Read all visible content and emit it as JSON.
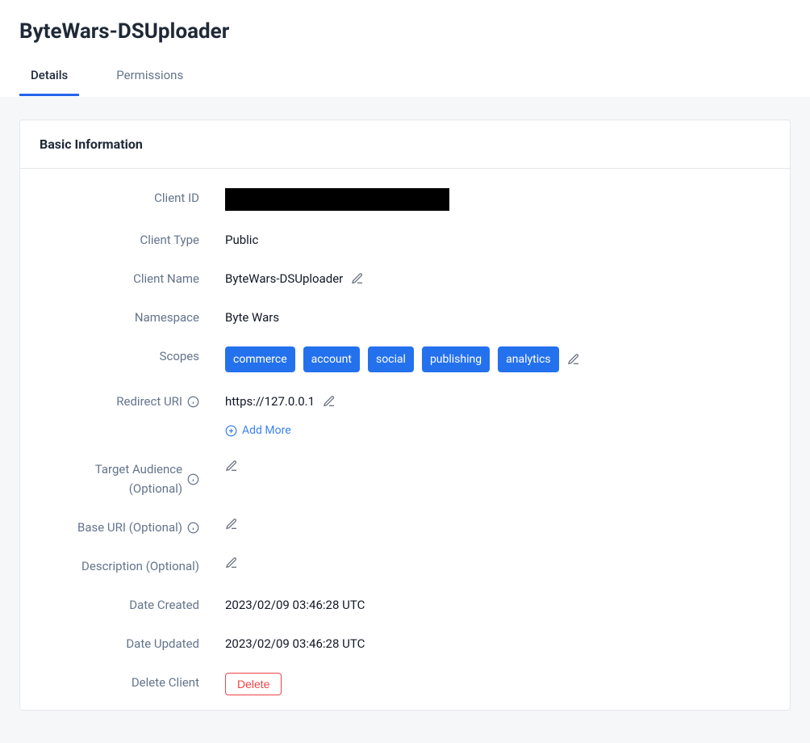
{
  "header": {
    "title": "ByteWars-DSUploader"
  },
  "tabs": {
    "details": "Details",
    "permissions": "Permissions"
  },
  "card": {
    "title": "Basic Information"
  },
  "labels": {
    "client_id": "Client ID",
    "client_type": "Client Type",
    "client_name": "Client Name",
    "namespace": "Namespace",
    "scopes": "Scopes",
    "redirect_uri": "Redirect URI",
    "target_audience": "Target Audience (Optional)",
    "base_uri": "Base URI (Optional)",
    "description": "Description (Optional)",
    "date_created": "Date Created",
    "date_updated": "Date Updated",
    "delete_client": "Delete Client"
  },
  "values": {
    "client_type": "Public",
    "client_name": "ByteWars-DSUploader",
    "namespace": "Byte Wars",
    "redirect_uri": "https://127.0.0.1",
    "date_created": "2023/02/09 03:46:28 UTC",
    "date_updated": "2023/02/09 03:46:28 UTC"
  },
  "scopes": [
    "commerce",
    "account",
    "social",
    "publishing",
    "analytics"
  ],
  "actions": {
    "add_more": "Add More",
    "delete": "Delete"
  }
}
